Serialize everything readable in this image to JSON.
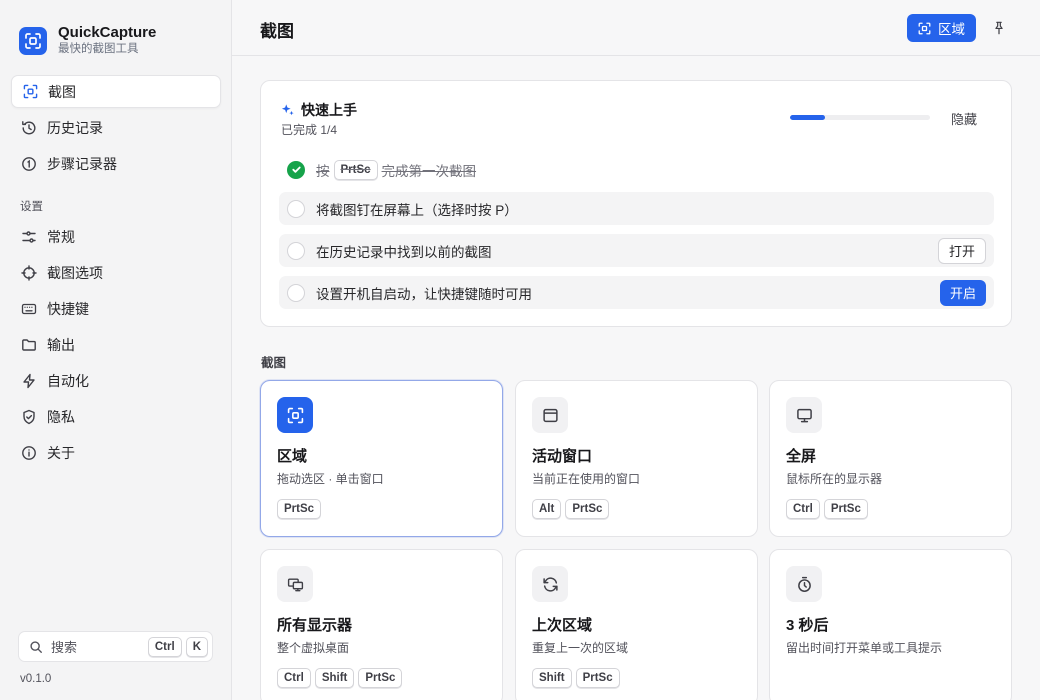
{
  "app": {
    "name": "QuickCapture",
    "tagline": "最快的截图工具"
  },
  "sidebar": {
    "items": [
      {
        "label": "截图",
        "icon": "region-capture-icon",
        "active": true
      },
      {
        "label": "历史记录",
        "icon": "history-icon"
      },
      {
        "label": "步骤记录器",
        "icon": "steps-icon"
      }
    ],
    "settings_label": "设置",
    "settings_items": [
      {
        "label": "常规",
        "icon": "sliders-icon"
      },
      {
        "label": "截图选项",
        "icon": "crosshair-icon"
      },
      {
        "label": "快捷键",
        "icon": "keyboard-icon"
      },
      {
        "label": "输出",
        "icon": "folder-icon"
      },
      {
        "label": "自动化",
        "icon": "bolt-icon"
      },
      {
        "label": "隐私",
        "icon": "shield-icon"
      },
      {
        "label": "关于",
        "icon": "info-icon"
      }
    ],
    "search": {
      "label": "搜索",
      "keys": [
        "Ctrl",
        "K"
      ]
    },
    "version": "v0.1.0"
  },
  "header": {
    "title": "截图",
    "region_button": "区域"
  },
  "quick_start": {
    "title": "快速上手",
    "progress_text": "已完成 1/4",
    "progress": 0.25,
    "hide_label": "隐藏",
    "tasks": [
      {
        "prefix": "按",
        "key": "PrtSc",
        "suffix": "完成第一次截图",
        "done": true
      },
      {
        "text": "将截图钉在屏幕上（选择时按 P）",
        "done": false
      },
      {
        "text": "在历史记录中找到以前的截图",
        "done": false,
        "button": "打开"
      },
      {
        "text": "设置开机自启动，让快捷键随时可用",
        "done": false,
        "button": "开启"
      }
    ]
  },
  "capture": {
    "section_label": "截图",
    "cards": [
      {
        "title": "区域",
        "desc": "拖动选区 · 单击窗口",
        "keys": [
          "PrtSc"
        ],
        "icon": "region-capture-icon",
        "selected": true
      },
      {
        "title": "活动窗口",
        "desc": "当前正在使用的窗口",
        "keys": [
          "Alt",
          "PrtSc"
        ],
        "icon": "window-icon"
      },
      {
        "title": "全屏",
        "desc": "鼠标所在的显示器",
        "keys": [
          "Ctrl",
          "PrtSc"
        ],
        "icon": "monitor-icon"
      },
      {
        "title": "所有显示器",
        "desc": "整个虚拟桌面",
        "keys": [
          "Ctrl",
          "Shift",
          "PrtSc"
        ],
        "icon": "multi-monitor-icon"
      },
      {
        "title": "上次区域",
        "desc": "重复上一次的区域",
        "keys": [
          "Shift",
          "PrtSc"
        ],
        "icon": "refresh-icon"
      },
      {
        "title": "3 秒后",
        "desc": "留出时间打开菜单或工具提示",
        "keys": [],
        "icon": "timer-icon"
      }
    ]
  },
  "colors": {
    "accent": "#2563eb",
    "success": "#16a34a"
  }
}
